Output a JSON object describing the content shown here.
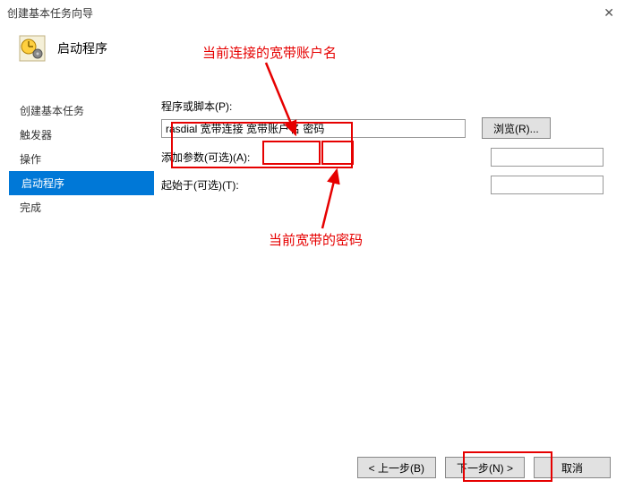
{
  "window": {
    "title": "创建基本任务向导"
  },
  "header": {
    "title": "启动程序"
  },
  "sidebar": {
    "items": [
      {
        "label": "创建基本任务"
      },
      {
        "label": "触发器"
      },
      {
        "label": "操作"
      },
      {
        "label": "启动程序"
      },
      {
        "label": "完成"
      }
    ]
  },
  "form": {
    "program_label": "程序或脚本(P):",
    "program_value": "rasdial 宽带连接 宽带账户名 密码",
    "browse_label": "浏览(R)...",
    "args_label": "添加参数(可选)(A):",
    "args_value": "",
    "startin_label": "起始于(可选)(T):",
    "startin_value": ""
  },
  "footer": {
    "back": "< 上一步(B)",
    "next": "下一步(N) >",
    "cancel": "取消"
  },
  "annotations": {
    "top_text": "当前连接的宽带账户名",
    "bottom_text": "当前宽带的密码"
  }
}
